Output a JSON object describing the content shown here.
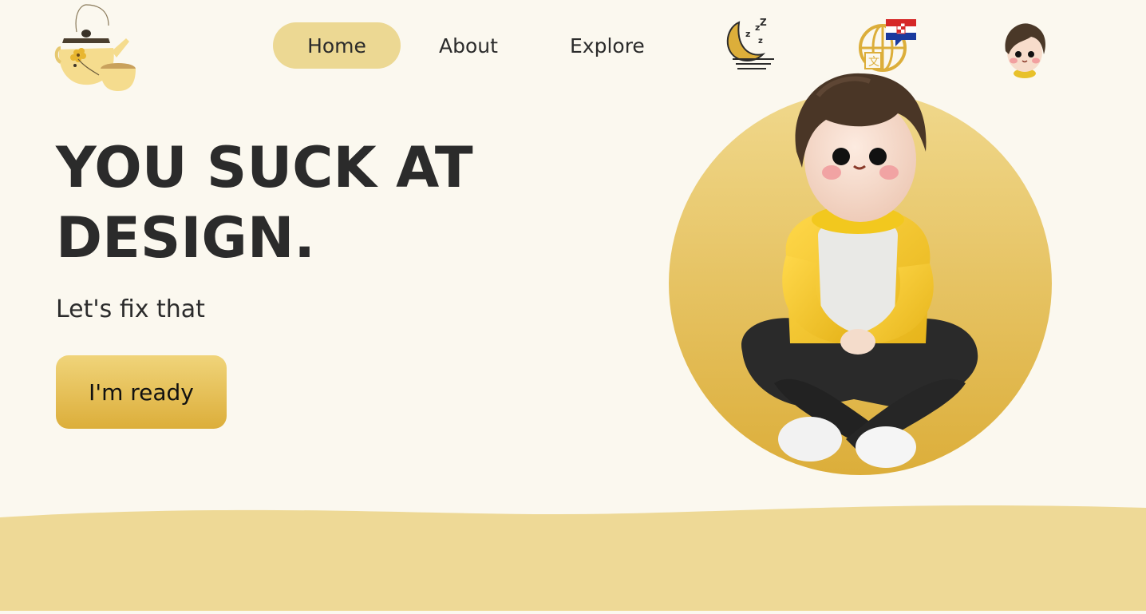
{
  "nav": {
    "logo_icon": "teapot-logo-icon",
    "items": [
      {
        "label": "Home",
        "active": true
      },
      {
        "label": "About",
        "active": false
      },
      {
        "label": "Explore",
        "active": false
      }
    ],
    "theme_icon": "moon-sleep-icon",
    "language_icon": "globe-translate-icon",
    "language_flag": "croatian-flag-icon",
    "avatar_icon": "avatar-icon"
  },
  "hero": {
    "headline_line1": "YOU SUCK AT",
    "headline_line2": "DESIGN.",
    "subtitle": "Let's fix that",
    "cta_label": "I'm ready",
    "illustration": "sitting-character-illustration"
  },
  "colors": {
    "background": "#fbf8ef",
    "accent": "#ecd893",
    "gold": "#dcae3a",
    "text": "#2b2b2b",
    "wave": "#eed996"
  }
}
